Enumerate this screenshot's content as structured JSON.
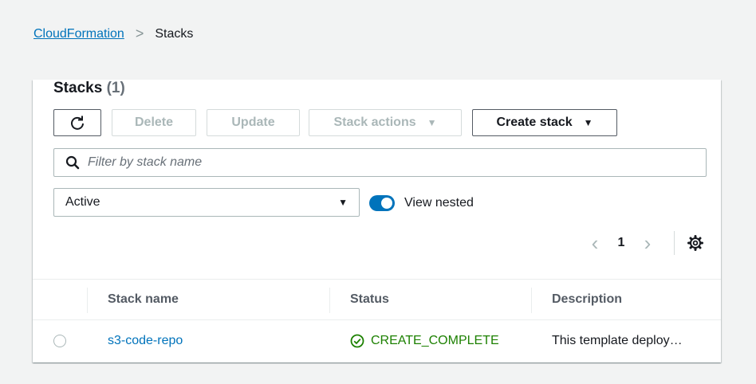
{
  "breadcrumb": {
    "root": "CloudFormation",
    "separator": ">",
    "current": "Stacks"
  },
  "panel": {
    "title": "Stacks",
    "count": "(1)"
  },
  "toolbar": {
    "refresh_icon": "refresh-icon",
    "delete_label": "Delete",
    "update_label": "Update",
    "stack_actions_label": "Stack actions",
    "create_stack_label": "Create stack"
  },
  "filter": {
    "placeholder": "Filter by stack name",
    "value": ""
  },
  "status_select": {
    "selected": "Active"
  },
  "view_nested": {
    "label": "View nested",
    "enabled": true
  },
  "pagination": {
    "current_page": "1"
  },
  "table": {
    "columns": [
      "Stack name",
      "Status",
      "Description"
    ],
    "rows": [
      {
        "stack_name": "s3-code-repo",
        "status": "CREATE_COMPLETE",
        "description": "This template deploy…"
      }
    ]
  },
  "colors": {
    "accent": "#0073bb",
    "success": "#1d8102",
    "background": "#f2f3f3"
  }
}
